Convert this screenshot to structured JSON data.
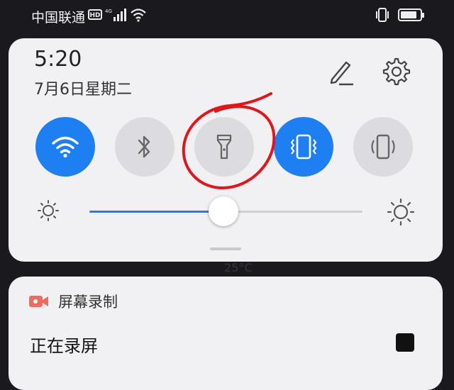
{
  "status_bar": {
    "carrier": "中国联通",
    "network_badge": "HD",
    "icons": [
      "hd-badge-icon",
      "signal-icon",
      "wifi-icon",
      "vibrate-icon",
      "battery-icon"
    ],
    "battery_level_percent": 80
  },
  "quick_panel": {
    "time": "5:20",
    "date": "7月6日星期二",
    "header_icons": [
      "edit-pencil-icon",
      "gear-icon"
    ],
    "tiles": [
      {
        "name": "wifi",
        "icon": "wifi-icon",
        "active": true
      },
      {
        "name": "bluetooth",
        "icon": "bluetooth-icon",
        "active": false
      },
      {
        "name": "flashlight",
        "icon": "flashlight-icon",
        "active": false,
        "annotated": true
      },
      {
        "name": "vibrate",
        "icon": "vibrate-icon",
        "active": true
      },
      {
        "name": "auto-rotate",
        "icon": "rotate-icon",
        "active": false
      }
    ],
    "brightness_percent": 49,
    "colors": {
      "active": "#1e7ff2",
      "inactive": "#dcdce0",
      "annotation": "#e0161b"
    }
  },
  "background": {
    "ghost_text": "25°C"
  },
  "notification": {
    "app_icon": "screen-record-icon",
    "app_name": "屏幕录制",
    "text": "正在录屏",
    "action_icon": "stop-icon"
  }
}
